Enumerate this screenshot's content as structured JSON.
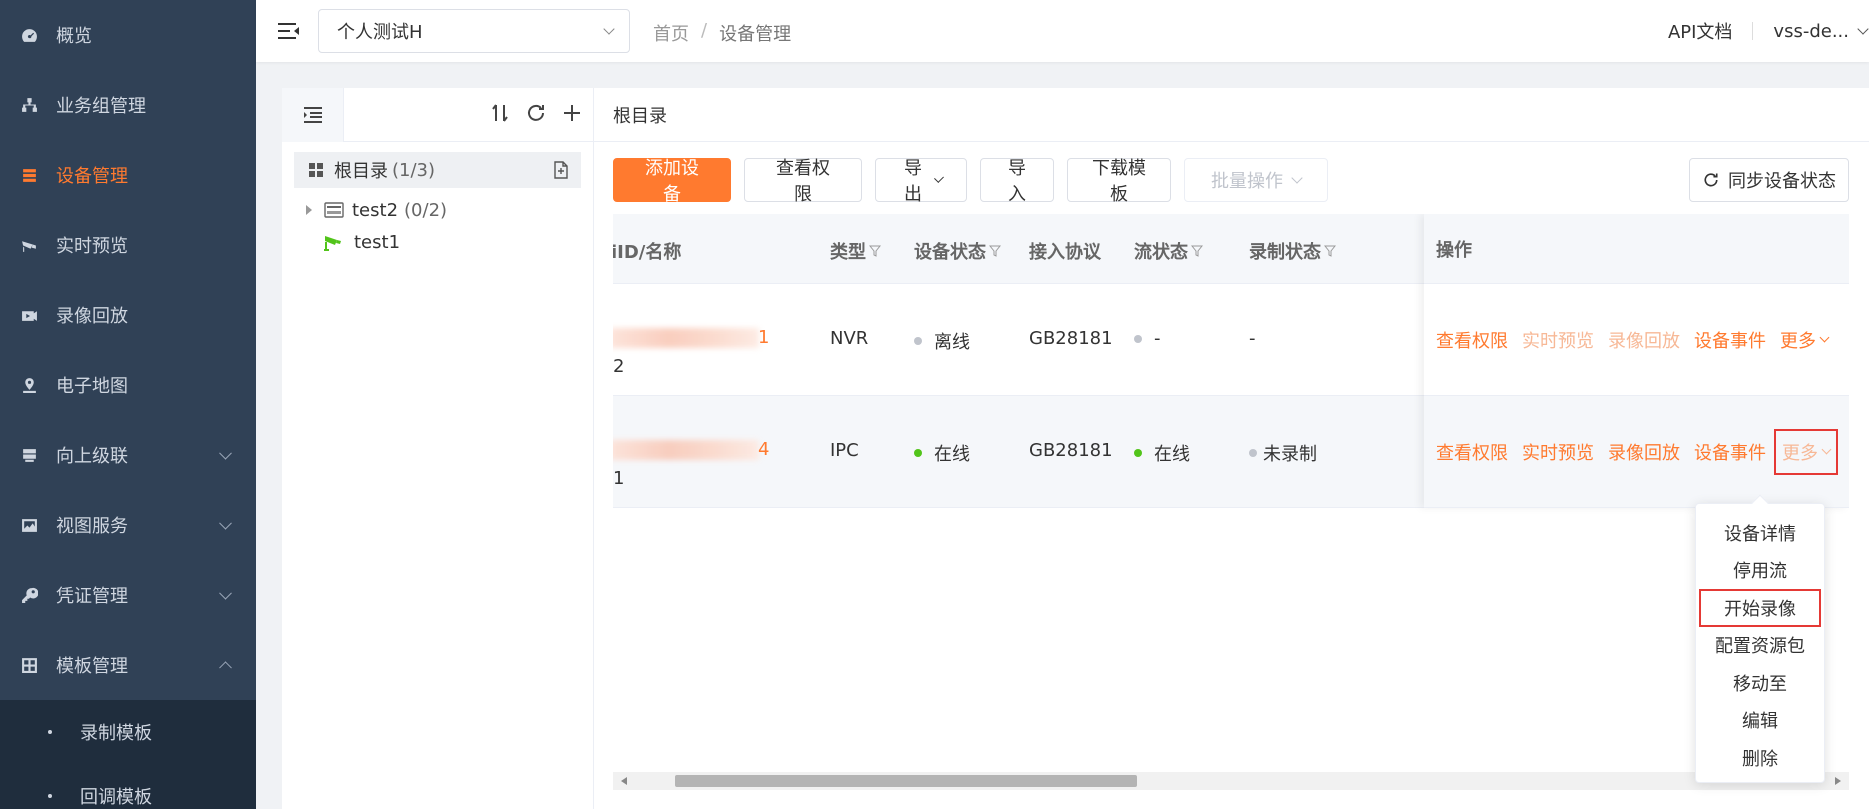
{
  "sidebar": {
    "items": [
      {
        "label": "概览",
        "icon": "dashboard-icon"
      },
      {
        "label": "业务组管理",
        "icon": "org-icon"
      },
      {
        "label": "设备管理",
        "icon": "device-icon",
        "active": true
      },
      {
        "label": "实时预览",
        "icon": "camera-icon"
      },
      {
        "label": "录像回放",
        "icon": "playback-icon"
      },
      {
        "label": "电子地图",
        "icon": "map-icon"
      },
      {
        "label": "向上级联",
        "icon": "cascade-icon",
        "expandable": true
      },
      {
        "label": "视图服务",
        "icon": "image-icon",
        "expandable": true
      },
      {
        "label": "凭证管理",
        "icon": "key-icon",
        "expandable": true
      },
      {
        "label": "模板管理",
        "icon": "grid-icon",
        "expanded": true
      }
    ],
    "sub_items": [
      {
        "label": "录制模板"
      },
      {
        "label": "回调模板"
      }
    ]
  },
  "header": {
    "project": "个人测试H",
    "breadcrumb": [
      "首页",
      "/",
      "设备管理"
    ],
    "api_doc": "API文档",
    "user": "vss-de..."
  },
  "tree": {
    "root_label": "根目录",
    "root_count": "(1/3)",
    "nodes": [
      {
        "label": "test2",
        "count": "(0/2)"
      },
      {
        "label": "test1",
        "count": ""
      }
    ]
  },
  "main": {
    "path": "根目录",
    "buttons": {
      "add": "添加设备",
      "perm": "查看权限",
      "export": "导出",
      "import": "导入",
      "download": "下载模板",
      "batch": "批量操作",
      "sync": "同步设备状态"
    }
  },
  "table": {
    "columns": {
      "id": "iID/名称",
      "type": "类型",
      "device_status": "设备状态",
      "protocol": "接入协议",
      "stream_status": "流状态",
      "record_status": "录制状态",
      "actions": "操作"
    },
    "rows": [
      {
        "id_tail": "1",
        "name_tail": "2",
        "type": "NVR",
        "device_status": "离线",
        "device_status_color": "#c0c4cc",
        "protocol": "GB28181",
        "stream_status": "-",
        "stream_color": "#c0c4cc",
        "record_status": "-",
        "record_dot": false
      },
      {
        "id_tail": "4",
        "name_tail": "1",
        "type": "IPC",
        "device_status": "在线",
        "device_status_color": "#52c41a",
        "protocol": "GB28181",
        "stream_status": "在线",
        "stream_color": "#52c41a",
        "record_status": "未录制",
        "record_dot": true
      }
    ],
    "actions": {
      "perm": "查看权限",
      "live": "实时预览",
      "playback": "录像回放",
      "events": "设备事件",
      "more": "更多"
    }
  },
  "dropdown": {
    "items": [
      "设备详情",
      "停用流",
      "开始录像",
      "配置资源包",
      "移动至",
      "编辑",
      "删除"
    ],
    "highlighted": "开始录像"
  },
  "colors": {
    "accent": "#ff7a2f",
    "sidebar_bg": "#304156",
    "online": "#52c41a",
    "offline": "#c0c4cc",
    "highlight_box": "#e53935"
  }
}
